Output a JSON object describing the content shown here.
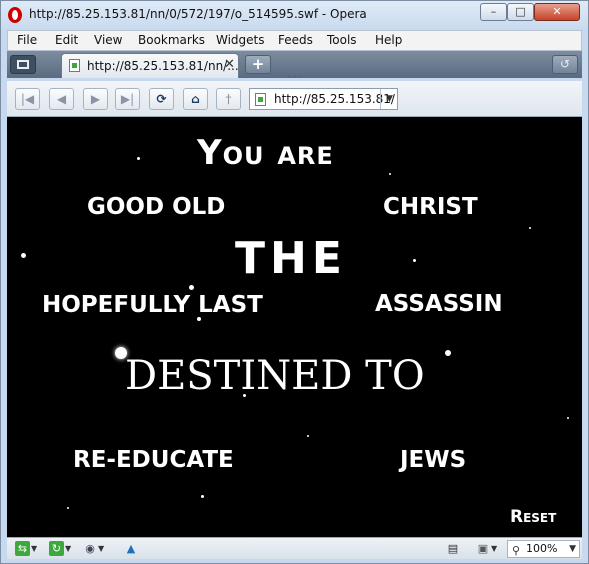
{
  "window": {
    "title": "http://85.25.153.81/nn/0/572/197/o_514595.swf - Opera",
    "minimize_label": "–",
    "maximize_label": "□",
    "close_label": "✕"
  },
  "menubar": {
    "items": [
      "File",
      "Edit",
      "View",
      "Bookmarks",
      "Widgets",
      "Feeds",
      "Tools",
      "Help"
    ]
  },
  "tabbar": {
    "tab_label": "http://85.25.153.81/nn/...",
    "tab_close": "✕",
    "new_tab": "+",
    "trash_icon": "↺",
    "grip": "•••"
  },
  "navbar": {
    "rewind": "|◀",
    "back": "◀",
    "forward": "▶",
    "fast_forward": "▶|",
    "reload": "⟳",
    "home": "⌂",
    "wand": "†",
    "address": "http://85.25.153.81/",
    "address_dropdown": "▼"
  },
  "flash": {
    "title": "You are",
    "left_1": "GOOD OLD",
    "right_1": "CHRIST",
    "middle": "THE",
    "left_2": "HOPEFULLY LAST",
    "right_2": "ASSASSIN",
    "destined": "DESTINED TO",
    "left_3": "RE-EDUCATE",
    "right_3": "JEWS",
    "reset": "Reset"
  },
  "statusbar": {
    "zoom": "100%",
    "zoom_dropdown": "▼"
  },
  "colors": {
    "content_background": "#000000",
    "text": "#ffffff",
    "opera_red": "#d10000"
  }
}
